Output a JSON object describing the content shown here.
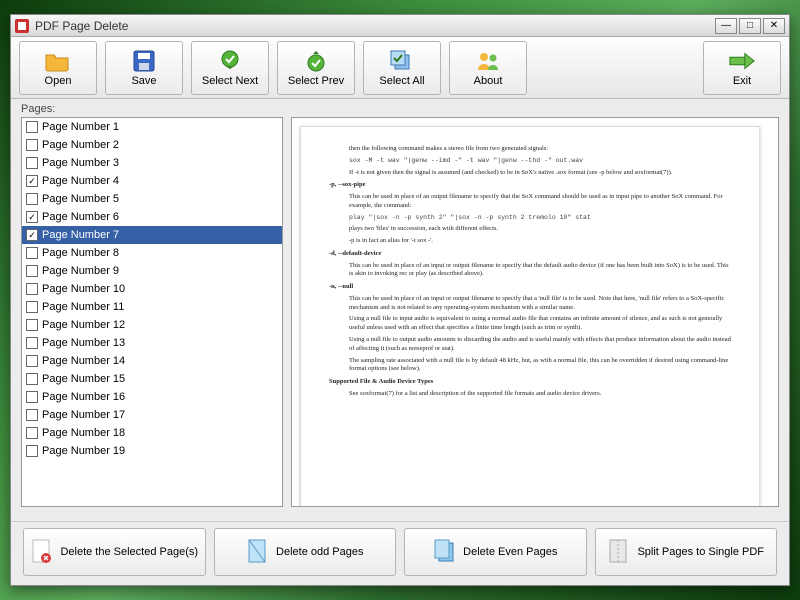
{
  "window": {
    "title": "PDF Page Delete"
  },
  "toolbar": {
    "open": "Open",
    "save": "Save",
    "select_next": "Select Next",
    "select_prev": "Select Prev",
    "select_all": "Select All",
    "about": "About",
    "exit": "Exit"
  },
  "pages_label": "Pages:",
  "pages": [
    {
      "label": "Page Number 1",
      "checked": false,
      "selected": false
    },
    {
      "label": "Page Number 2",
      "checked": false,
      "selected": false
    },
    {
      "label": "Page Number 3",
      "checked": false,
      "selected": false
    },
    {
      "label": "Page Number 4",
      "checked": true,
      "selected": false
    },
    {
      "label": "Page Number 5",
      "checked": false,
      "selected": false
    },
    {
      "label": "Page Number 6",
      "checked": true,
      "selected": false
    },
    {
      "label": "Page Number 7",
      "checked": true,
      "selected": true
    },
    {
      "label": "Page Number 8",
      "checked": false,
      "selected": false
    },
    {
      "label": "Page Number 9",
      "checked": false,
      "selected": false
    },
    {
      "label": "Page Number 10",
      "checked": false,
      "selected": false
    },
    {
      "label": "Page Number 11",
      "checked": false,
      "selected": false
    },
    {
      "label": "Page Number 12",
      "checked": false,
      "selected": false
    },
    {
      "label": "Page Number 13",
      "checked": false,
      "selected": false
    },
    {
      "label": "Page Number 14",
      "checked": false,
      "selected": false
    },
    {
      "label": "Page Number 15",
      "checked": false,
      "selected": false
    },
    {
      "label": "Page Number 16",
      "checked": false,
      "selected": false
    },
    {
      "label": "Page Number 17",
      "checked": false,
      "selected": false
    },
    {
      "label": "Page Number 18",
      "checked": false,
      "selected": false
    },
    {
      "label": "Page Number 19",
      "checked": false,
      "selected": false
    }
  ],
  "preview_doc": {
    "lines": [
      {
        "cls": "body",
        "text": "then the following command makes a stereo file from two generated signals:"
      },
      {
        "cls": "mono",
        "text": "sox -M -t wav \"|genw --imd -\" -t wav \"|genw --thd -\" out.wav"
      },
      {
        "cls": "body",
        "text": "If -t is not given then the signal is assumed (and checked) to be in SoX's native .sox format (see -p below and soxformat(7))."
      },
      {
        "cls": "opt",
        "text": "-p, --sox-pipe"
      },
      {
        "cls": "body",
        "text": "This can be used in place of an output filename to specify that the SoX command should be used as in input pipe to another SoX command. For example, the command:"
      },
      {
        "cls": "mono",
        "text": "play \"|sox -n -p synth 2\" \"|sox -n -p synth 2 tremolo 10\" stat"
      },
      {
        "cls": "body",
        "text": "plays two 'files' in succession, each with different effects."
      },
      {
        "cls": "body",
        "text": "-p is in fact an alias for '-t sox -'."
      },
      {
        "cls": "opt",
        "text": "-d, --default-device"
      },
      {
        "cls": "body",
        "text": "This can be used in place of an input or output filename to specify that the default audio device (if one has been built into SoX) is to be used. This is akin to invoking rec or play (as described above)."
      },
      {
        "cls": "opt",
        "text": "-n, --null"
      },
      {
        "cls": "body",
        "text": "This can be used in place of an input or output filename to specify that a 'null file' is to be used. Note that here, 'null file' refers to a SoX-specific mechanism and is not related to any operating-system mechanism with a similar name."
      },
      {
        "cls": "body",
        "text": "Using a null file to input audio is equivalent to using a normal audio file that contains an infinite amount of silence, and as such is not generally useful unless used with an effect that specifies a finite time length (such as trim or synth)."
      },
      {
        "cls": "body",
        "text": "Using a null file to output audio amounts to discarding the audio and is useful mainly with effects that produce information about the audio instead of affecting it (such as noiseprof or stat)."
      },
      {
        "cls": "body",
        "text": "The sampling rate associated with a null file is by default 48 kHz, but, as with a normal file, this can be overridden if desired using command-line format options (see below)."
      },
      {
        "cls": "opt",
        "text": "Supported File & Audio Device Types"
      },
      {
        "cls": "body",
        "text": "See soxformat(7) for a list and description of the supported file formats and audio device drivers."
      }
    ]
  },
  "bottom": {
    "delete_selected": "Delete the Selected Page(s)",
    "delete_odd": "Delete odd Pages",
    "delete_even": "Delete Even Pages",
    "split": "Split Pages to Single PDF"
  }
}
